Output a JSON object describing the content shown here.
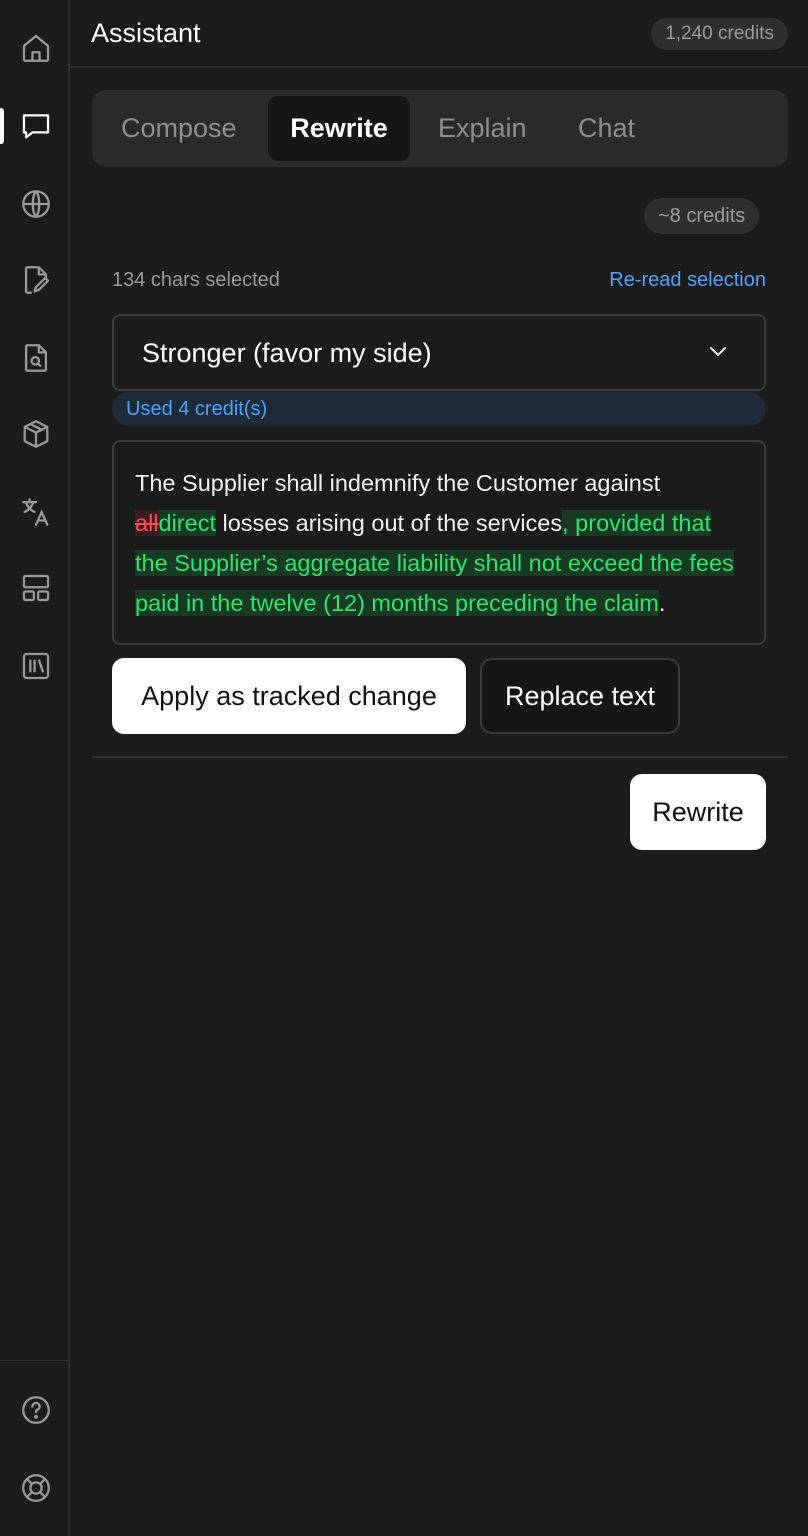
{
  "header": {
    "title": "Assistant",
    "credits": "1,240 credits"
  },
  "tabs": [
    {
      "label": "Compose",
      "active": false
    },
    {
      "label": "Rewrite",
      "active": true
    },
    {
      "label": "Explain",
      "active": false
    },
    {
      "label": "Chat",
      "active": false
    }
  ],
  "estimate": "~8 credits",
  "selection": {
    "count_text": "134 chars selected",
    "reread_label": "Re-read selection"
  },
  "tone_select": {
    "value": "Stronger (favor my side)",
    "icon": "chevron-down-icon"
  },
  "usage": {
    "text": "Used 4 credit(s)"
  },
  "diff": {
    "prefix": "The Supplier shall indemnify the Customer against ",
    "deleted": "all",
    "inserted_1": "direct",
    "middle": " losses arising out of the services",
    "inserted_2": ", provided that the Supplier’s aggregate liability shall not exceed the fees paid in the twelve (12) months preceding the claim",
    "suffix": "."
  },
  "actions": {
    "apply": "Apply as tracked change",
    "replace": "Replace text",
    "rewrite": "Rewrite"
  },
  "rail": {
    "icons": [
      "home-icon",
      "chat-icon",
      "globe-icon",
      "document-edit-icon",
      "document-search-icon",
      "cube-icon",
      "translate-icon",
      "layout-icon",
      "library-icon"
    ],
    "bottom_icons": [
      "help-icon",
      "support-lifebuoy-icon"
    ],
    "active": "chat-icon"
  },
  "colors": {
    "accent": "#4fa3ff",
    "insert": "#2ee66b",
    "delete": "#ff4d4d",
    "background": "#1b1b1b"
  }
}
